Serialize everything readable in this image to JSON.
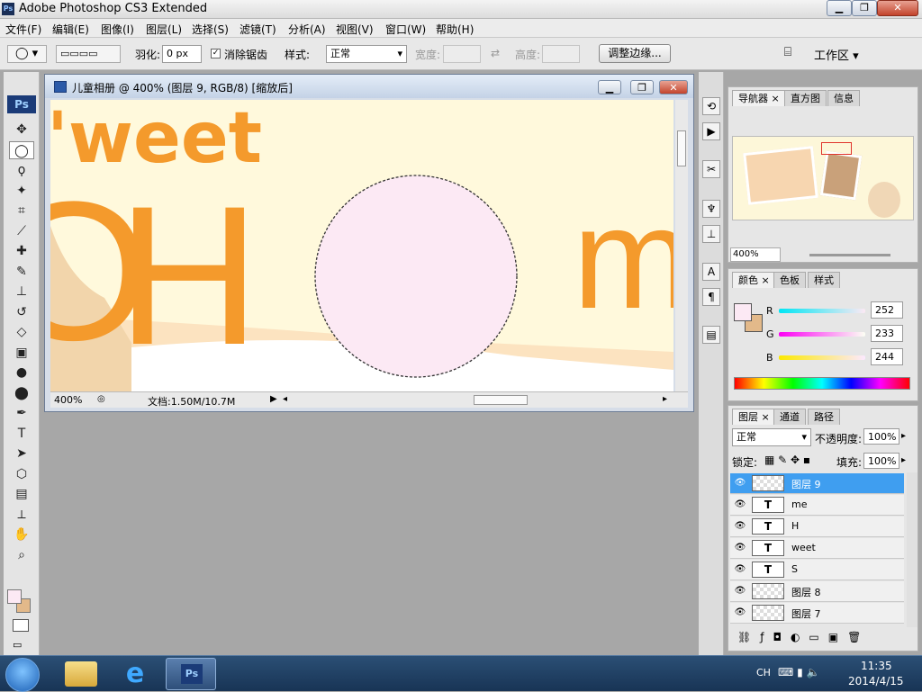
{
  "window": {
    "title": "Adobe Photoshop CS3 Extended",
    "controls": {
      "minimize": "▁",
      "restore": "❐",
      "close": "✕"
    }
  },
  "menu": [
    "文件(F)",
    "编辑(E)",
    "图像(I)",
    "图层(L)",
    "选择(S)",
    "滤镜(T)",
    "分析(A)",
    "视图(V)",
    "窗口(W)",
    "帮助(H)"
  ],
  "options": {
    "feather_label": "羽化:",
    "feather_value": "0 px",
    "antialias_label": "消除锯齿",
    "style_label": "样式:",
    "style_value": "正常",
    "width_label": "宽度:",
    "height_label": "高度:",
    "refine_button": "调整边缘...",
    "workspace_button": "工作区 ▾"
  },
  "document": {
    "title": "儿童相册 @ 400% (图层 9, RGB/8) [缩放后]",
    "zoom": "400%",
    "doc_size": "文档:1.50M/10.7M",
    "canvas_text": {
      "weet": "'weet",
      "h": "H",
      "m": "m"
    }
  },
  "navigator": {
    "tabs": [
      "导航器",
      "直方图",
      "信息"
    ],
    "zoom": "400%"
  },
  "color_panel": {
    "tabs": [
      "颜色",
      "色板",
      "样式"
    ],
    "r_label": "R",
    "r_value": "252",
    "g_label": "G",
    "g_value": "233",
    "b_label": "B",
    "b_value": "244",
    "fg_color": "#fce9f4",
    "bg_color": "#e3b98a"
  },
  "layers_panel": {
    "tabs": [
      "图层",
      "通道",
      "路径"
    ],
    "blend_mode": "正常",
    "opacity_label": "不透明度:",
    "opacity_value": "100%",
    "lock_label": "锁定:",
    "fill_label": "填充:",
    "fill_value": "100%",
    "layers": [
      {
        "name": "图层 9",
        "kind": "pixel",
        "selected": true
      },
      {
        "name": "me",
        "kind": "text",
        "selected": false
      },
      {
        "name": "H",
        "kind": "text",
        "selected": false
      },
      {
        "name": "weet",
        "kind": "text",
        "selected": false
      },
      {
        "name": "S",
        "kind": "text",
        "selected": false
      },
      {
        "name": "图层 8",
        "kind": "pixel",
        "selected": false
      },
      {
        "name": "图层 7",
        "kind": "pixel",
        "selected": false
      }
    ],
    "text_thumb": "T"
  },
  "tool_icons": [
    "move-icon",
    "elliptical-marquee-icon",
    "lasso-icon",
    "magic-wand-icon",
    "crop-icon",
    "slice-icon",
    "healing-brush-icon",
    "brush-icon",
    "clone-stamp-icon",
    "history-brush-icon",
    "eraser-icon",
    "gradient-icon",
    "blur-icon",
    "dodge-icon",
    "pen-icon",
    "type-icon",
    "path-select-icon",
    "shape-icon",
    "notes-icon",
    "eyedropper-icon",
    "hand-icon",
    "zoom-icon"
  ],
  "tool_glyphs": [
    "✥",
    "◯",
    "ϙ",
    "✦",
    "⌗",
    "⟋",
    "✚",
    "✎",
    "⊥",
    "↺",
    "◇",
    "▣",
    "●",
    "⬤",
    "✒",
    "T",
    "➤",
    "⬡",
    "▤",
    "⟂",
    "✋",
    "⌕"
  ],
  "taskbar": {
    "lang": "CH",
    "time": "11:35",
    "date": "2014/4/15"
  }
}
